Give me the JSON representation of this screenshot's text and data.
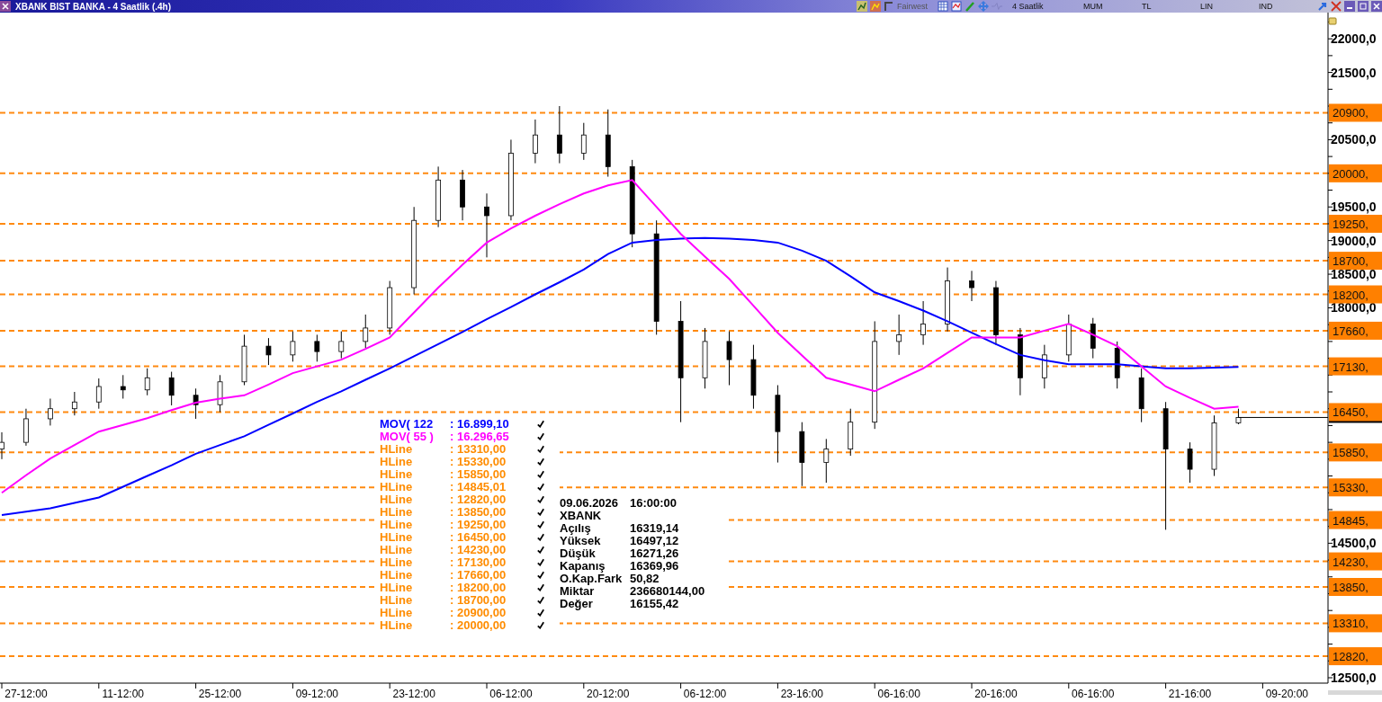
{
  "window": {
    "title": "XBANK BIST BANKA - 4 Saatlik (.4h)"
  },
  "toolbar": {
    "brand": "Fairwest",
    "items": [
      "4 Saatlik",
      "MUM",
      "TL",
      "LIN",
      "IND"
    ]
  },
  "chart": {
    "chart_data": {
      "type": "candlestick",
      "ylim": [
        12420,
        22390
      ],
      "categories": [
        null,
        "27-12:00",
        null,
        null,
        null,
        "11-12:00",
        null,
        null,
        null,
        "25-12:00",
        null,
        null,
        null,
        "09-12:00",
        null,
        null,
        null,
        "23-12:00",
        null,
        null,
        null,
        "06-12:00",
        null,
        null,
        null,
        "20-12:00",
        null,
        null,
        null,
        "06-12:00",
        null,
        null,
        null,
        "23-16:00",
        null,
        null,
        null,
        "06-16:00",
        null,
        null,
        null,
        "20-16:00",
        null,
        null,
        null,
        "06-16:00",
        null,
        null,
        null,
        "21-16:00",
        null,
        null,
        null,
        "09-20:00"
      ],
      "yticks": [
        {
          "value": 22000,
          "label": "22000,0"
        },
        {
          "value": 21500,
          "label": "21500,0"
        },
        {
          "value": 20500,
          "label": "20500,0"
        },
        {
          "value": 19500,
          "label": "19500,0"
        },
        {
          "value": 19000,
          "label": "19000,0"
        },
        {
          "value": 18500,
          "label": "18500,0"
        },
        {
          "value": 18000,
          "label": "18000,0"
        },
        {
          "value": 14500,
          "label": "14500,0"
        },
        {
          "value": 12500,
          "label": "12500,0"
        }
      ],
      "ohlc": [
        [
          15900,
          16150,
          15750,
          16000
        ],
        [
          16000,
          16500,
          15950,
          16350
        ],
        [
          16350,
          16650,
          16250,
          16500
        ],
        [
          16500,
          16750,
          16400,
          16600
        ],
        [
          16600,
          16950,
          16500,
          16830
        ],
        [
          16830,
          17000,
          16650,
          16780
        ],
        [
          16780,
          17100,
          16700,
          16960
        ],
        [
          16960,
          17050,
          16550,
          16700
        ],
        [
          16700,
          16800,
          16350,
          16560
        ],
        [
          16560,
          17000,
          16450,
          16900
        ],
        [
          16900,
          17600,
          16850,
          17430
        ],
        [
          17430,
          17550,
          17150,
          17300
        ],
        [
          17300,
          17650,
          17200,
          17500
        ],
        [
          17500,
          17600,
          17200,
          17350
        ],
        [
          17350,
          17650,
          17250,
          17500
        ],
        [
          17500,
          17900,
          17400,
          17700
        ],
        [
          17700,
          18400,
          17600,
          18300
        ],
        [
          18300,
          19500,
          18200,
          19300
        ],
        [
          19300,
          20100,
          19200,
          19900
        ],
        [
          19900,
          20050,
          19300,
          19500
        ],
        [
          19500,
          19700,
          18750,
          19370
        ],
        [
          19370,
          20500,
          19300,
          20300
        ],
        [
          20300,
          20800,
          20150,
          20570
        ],
        [
          20570,
          21000,
          20150,
          20300
        ],
        [
          20300,
          20750,
          20200,
          20570
        ],
        [
          20570,
          20950,
          19950,
          20100
        ],
        [
          20100,
          20200,
          18900,
          19100
        ],
        [
          19100,
          19300,
          17600,
          17800
        ],
        [
          17800,
          18100,
          16300,
          16960
        ],
        [
          16960,
          17700,
          16800,
          17500
        ],
        [
          17500,
          17650,
          16850,
          17230
        ],
        [
          17230,
          17450,
          16500,
          16700
        ],
        [
          16700,
          16850,
          15700,
          16160
        ],
        [
          16160,
          16300,
          15350,
          15700
        ],
        [
          15700,
          16050,
          15400,
          15900
        ],
        [
          15900,
          16500,
          15800,
          16300
        ],
        [
          16300,
          17800,
          16200,
          17500
        ],
        [
          17500,
          17900,
          17300,
          17600
        ],
        [
          17600,
          18100,
          17450,
          17760
        ],
        [
          17760,
          18600,
          17650,
          18400
        ],
        [
          18400,
          18550,
          18100,
          18300
        ],
        [
          18300,
          18400,
          17450,
          17600
        ],
        [
          17600,
          17700,
          16700,
          16960
        ],
        [
          16960,
          17450,
          16800,
          17300
        ],
        [
          17300,
          17900,
          17200,
          17760
        ],
        [
          17760,
          17850,
          17250,
          17400
        ],
        [
          17400,
          17500,
          16800,
          16960
        ],
        [
          16960,
          17100,
          16300,
          16500
        ],
        [
          16500,
          16600,
          14700,
          15900
        ],
        [
          15900,
          16000,
          15400,
          15600
        ],
        [
          15600,
          16400,
          15500,
          16290
        ],
        [
          16290,
          16500,
          16270,
          16370
        ],
        null,
        null
      ],
      "series": [
        {
          "name": "MOV( 122",
          "type": "line",
          "color": "#0000ff",
          "values": [
            14920,
            14970,
            15020,
            15100,
            15180,
            15340,
            15500,
            15660,
            15830,
            15960,
            16090,
            16260,
            16430,
            16600,
            16760,
            16930,
            17100,
            17280,
            17460,
            17640,
            17830,
            18010,
            18200,
            18380,
            18570,
            18800,
            18970,
            19010,
            19030,
            19040,
            19030,
            19010,
            18970,
            18850,
            18700,
            18470,
            18230,
            18100,
            17960,
            17800,
            17630,
            17460,
            17300,
            17220,
            17160,
            17160,
            17160,
            17130,
            17100,
            17100,
            17110,
            17120,
            null,
            null
          ]
        },
        {
          "name": "MOV( 55 )",
          "type": "line",
          "color": "#ff00ff",
          "values": [
            15250,
            15510,
            15760,
            15960,
            16160,
            16260,
            16360,
            16480,
            16590,
            16650,
            16700,
            16860,
            17030,
            17130,
            17230,
            17390,
            17560,
            17930,
            18300,
            18640,
            18970,
            19180,
            19370,
            19540,
            19700,
            19820,
            19900,
            19500,
            19100,
            18760,
            18430,
            18030,
            17630,
            17290,
            16960,
            16860,
            16760,
            16930,
            17100,
            17330,
            17560,
            17560,
            17560,
            17660,
            17760,
            17600,
            17430,
            17130,
            16830,
            16660,
            16500,
            16530,
            null,
            null
          ]
        }
      ],
      "ref_lines": [
        {
          "axis": "y",
          "value": 20900,
          "label": "20900,"
        },
        {
          "axis": "y",
          "value": 20000,
          "label": "20000,"
        },
        {
          "axis": "y",
          "value": 19250,
          "label": "19250,"
        },
        {
          "axis": "y",
          "value": 18700,
          "label": "18700,"
        },
        {
          "axis": "y",
          "value": 18200,
          "label": "18200,"
        },
        {
          "axis": "y",
          "value": 17660,
          "label": "17660,"
        },
        {
          "axis": "y",
          "value": 17130,
          "label": "17130,"
        },
        {
          "axis": "y",
          "value": 16450,
          "label": "16450,"
        },
        {
          "axis": "y",
          "value": 15850,
          "label": "15850,"
        },
        {
          "axis": "y",
          "value": 15330,
          "label": "15330,"
        },
        {
          "axis": "y",
          "value": 14845,
          "label": "14845,"
        },
        {
          "axis": "y",
          "value": 14230,
          "label": "14230,"
        },
        {
          "axis": "y",
          "value": 13850,
          "label": "13850,"
        },
        {
          "axis": "y",
          "value": 13310,
          "label": "13310,"
        },
        {
          "axis": "y",
          "value": 12820,
          "label": "12820,"
        }
      ]
    }
  },
  "legend": [
    {
      "kind": "series",
      "value": ": 16.899,10"
    },
    {
      "kind": "series",
      "value": ": 16.296,65"
    },
    {
      "name": "HLine",
      "value": ": 13310,00",
      "color": "#ff8c00"
    },
    {
      "name": "HLine",
      "value": ": 15330,00",
      "color": "#ff8c00"
    },
    {
      "name": "HLine",
      "value": ": 15850,00",
      "color": "#ff8c00"
    },
    {
      "name": "HLine",
      "value": ": 14845,01",
      "color": "#ff8c00"
    },
    {
      "name": "HLine",
      "value": ": 12820,00",
      "color": "#ff8c00"
    },
    {
      "name": "HLine",
      "value": ": 13850,00",
      "color": "#ff8c00"
    },
    {
      "name": "HLine",
      "value": ": 19250,00",
      "color": "#ff8c00"
    },
    {
      "name": "HLine",
      "value": ": 16450,00",
      "color": "#ff8c00"
    },
    {
      "name": "HLine",
      "value": ": 14230,00",
      "color": "#ff8c00"
    },
    {
      "name": "HLine",
      "value": ": 17130,00",
      "color": "#ff8c00"
    },
    {
      "name": "HLine",
      "value": ": 17660,00",
      "color": "#ff8c00"
    },
    {
      "name": "HLine",
      "value": ": 18200,00",
      "color": "#ff8c00"
    },
    {
      "name": "HLine",
      "value": ": 18700,00",
      "color": "#ff8c00"
    },
    {
      "name": "HLine",
      "value": ": 20900,00",
      "color": "#ff8c00"
    },
    {
      "name": "HLine",
      "value": ": 20000,00",
      "color": "#ff8c00"
    }
  ],
  "info": {
    "date": "09.06.2026",
    "time": "16:00:00",
    "symbol": "XBANK",
    "rows": [
      {
        "label": "Açılış",
        "value": "16319,14"
      },
      {
        "label": "Yüksek",
        "value": "16497,12"
      },
      {
        "label": "Düşük",
        "value": "16271,26"
      },
      {
        "label": "Kapanış",
        "value": "16369,96"
      },
      {
        "label": "O.Kap.Fark",
        "value": "50,82"
      },
      {
        "label": "Miktar",
        "value": "236680144,00"
      },
      {
        "label": "Değer",
        "value": "16155,42"
      }
    ]
  }
}
